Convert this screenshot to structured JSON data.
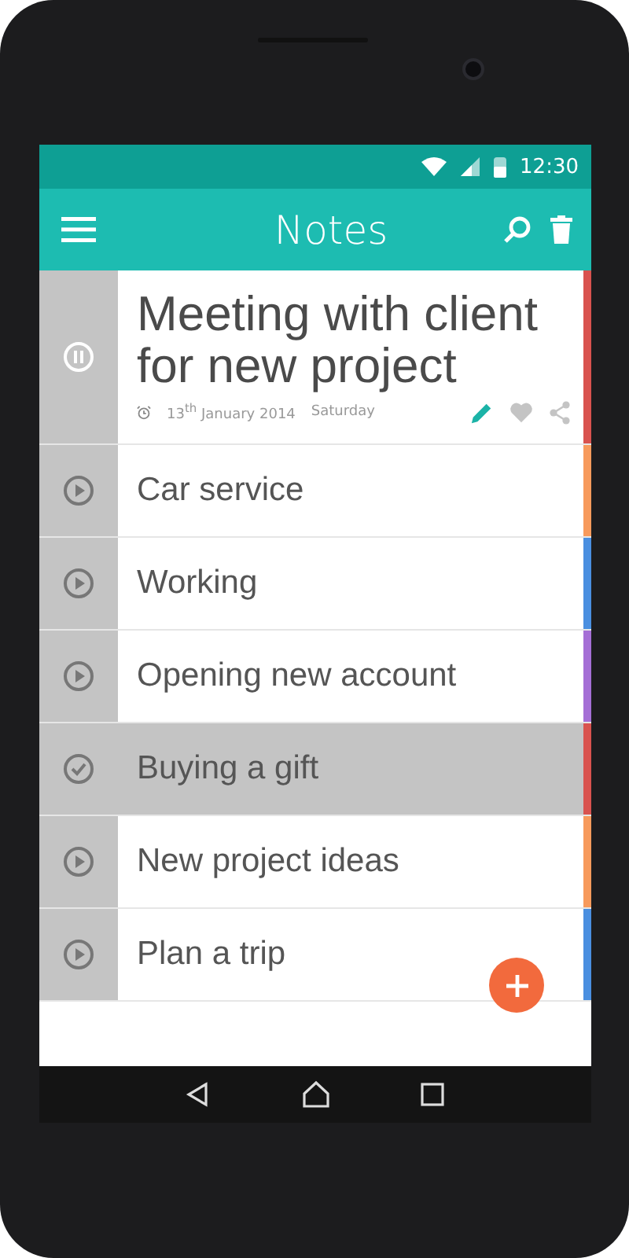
{
  "status_bar": {
    "time": "12:30"
  },
  "app_bar": {
    "title": "Notes"
  },
  "notes": [
    {
      "title": "Meeting with client for new project",
      "kind": "paused",
      "expanded": true,
      "done": false,
      "color": "#d9534f",
      "date": "13$^{th}$ January 2014",
      "day": "Saturday"
    },
    {
      "title": "Car service",
      "kind": "ready",
      "expanded": false,
      "done": false,
      "color": "#f79a5c"
    },
    {
      "title": "Working",
      "kind": "ready",
      "expanded": false,
      "done": false,
      "color": "#4a8fe0"
    },
    {
      "title": "Opening new account",
      "kind": "ready",
      "expanded": false,
      "done": false,
      "color": "#a56fd6"
    },
    {
      "title": "Buying a gift",
      "kind": "finished",
      "expanded": false,
      "done": true,
      "color": "#d9534f"
    },
    {
      "title": "New project ideas",
      "kind": "ready",
      "expanded": false,
      "done": false,
      "color": "#f79a5c"
    },
    {
      "title": "Plan a trip",
      "kind": "ready",
      "expanded": false,
      "done": false,
      "color": "#4a8fe0"
    }
  ]
}
